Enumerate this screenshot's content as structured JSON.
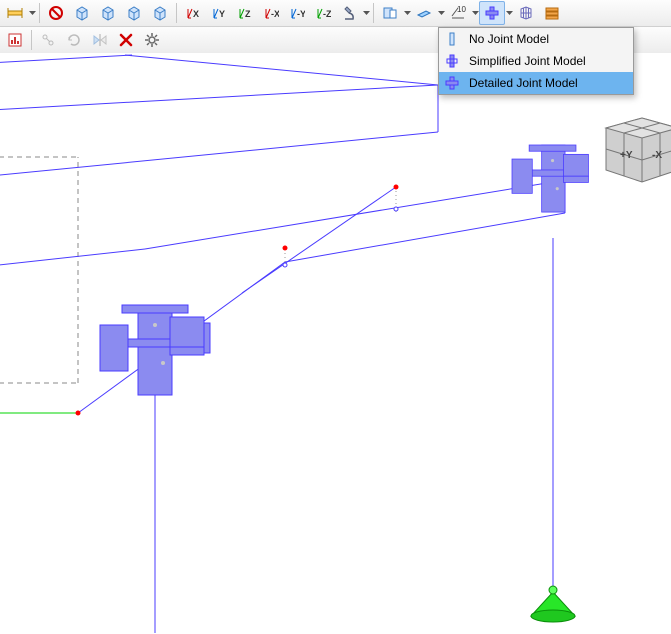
{
  "toolbar1": {
    "items": [
      {
        "name": "span-tool-icon"
      },
      {
        "name": "dd"
      },
      {
        "name": "sep"
      },
      {
        "name": "symbol-alpha-icon"
      },
      {
        "name": "box-front-icon"
      },
      {
        "name": "box-top-icon"
      },
      {
        "name": "box-side-icon"
      },
      {
        "name": "box-iso-icon"
      },
      {
        "name": "sep"
      },
      {
        "name": "axis-x",
        "letter": "X",
        "color": "#d00000"
      },
      {
        "name": "axis-y",
        "letter": "Y",
        "color": "#0066d6"
      },
      {
        "name": "axis-z",
        "letter": "Z",
        "color": "#00a000"
      },
      {
        "name": "axis-neg-x",
        "letter": "-X",
        "color": "#d00000"
      },
      {
        "name": "axis-neg-y",
        "letter": "-Y",
        "color": "#0066d6"
      },
      {
        "name": "axis-neg-z",
        "letter": "-Z",
        "color": "#00a000"
      },
      {
        "name": "microscope-icon"
      },
      {
        "name": "dd"
      },
      {
        "name": "sep"
      },
      {
        "name": "boundary-icon"
      },
      {
        "name": "dd"
      },
      {
        "name": "plane-icon"
      },
      {
        "name": "dd"
      },
      {
        "name": "offset-10",
        "text": "10"
      },
      {
        "name": "dd"
      },
      {
        "name": "joint-model-icon",
        "active": true
      },
      {
        "name": "dd"
      },
      {
        "name": "grid3d-icon"
      },
      {
        "name": "stack-icon"
      }
    ]
  },
  "toolbar2": {
    "items": [
      {
        "name": "chart-icon"
      },
      {
        "name": "sep"
      },
      {
        "name": "link-icon",
        "disabled": true
      },
      {
        "name": "refresh-icon",
        "disabled": true
      },
      {
        "name": "mirror-icon",
        "disabled": true
      },
      {
        "name": "delete-x-icon"
      },
      {
        "name": "gear-icon"
      }
    ]
  },
  "menu": {
    "items": [
      {
        "label": "No Joint Model",
        "selected": false
      },
      {
        "label": "Simplified Joint Model",
        "selected": false
      },
      {
        "label": "Detailed Joint Model",
        "selected": true
      }
    ]
  },
  "axis_cube": {
    "labels": [
      "+Y",
      "-X"
    ]
  },
  "colors": {
    "wire": "#4a3bff",
    "node": "#ff0000",
    "accent": "#7b7bf0",
    "ground": "#00d400",
    "menu_sel": "#6db4ef"
  }
}
